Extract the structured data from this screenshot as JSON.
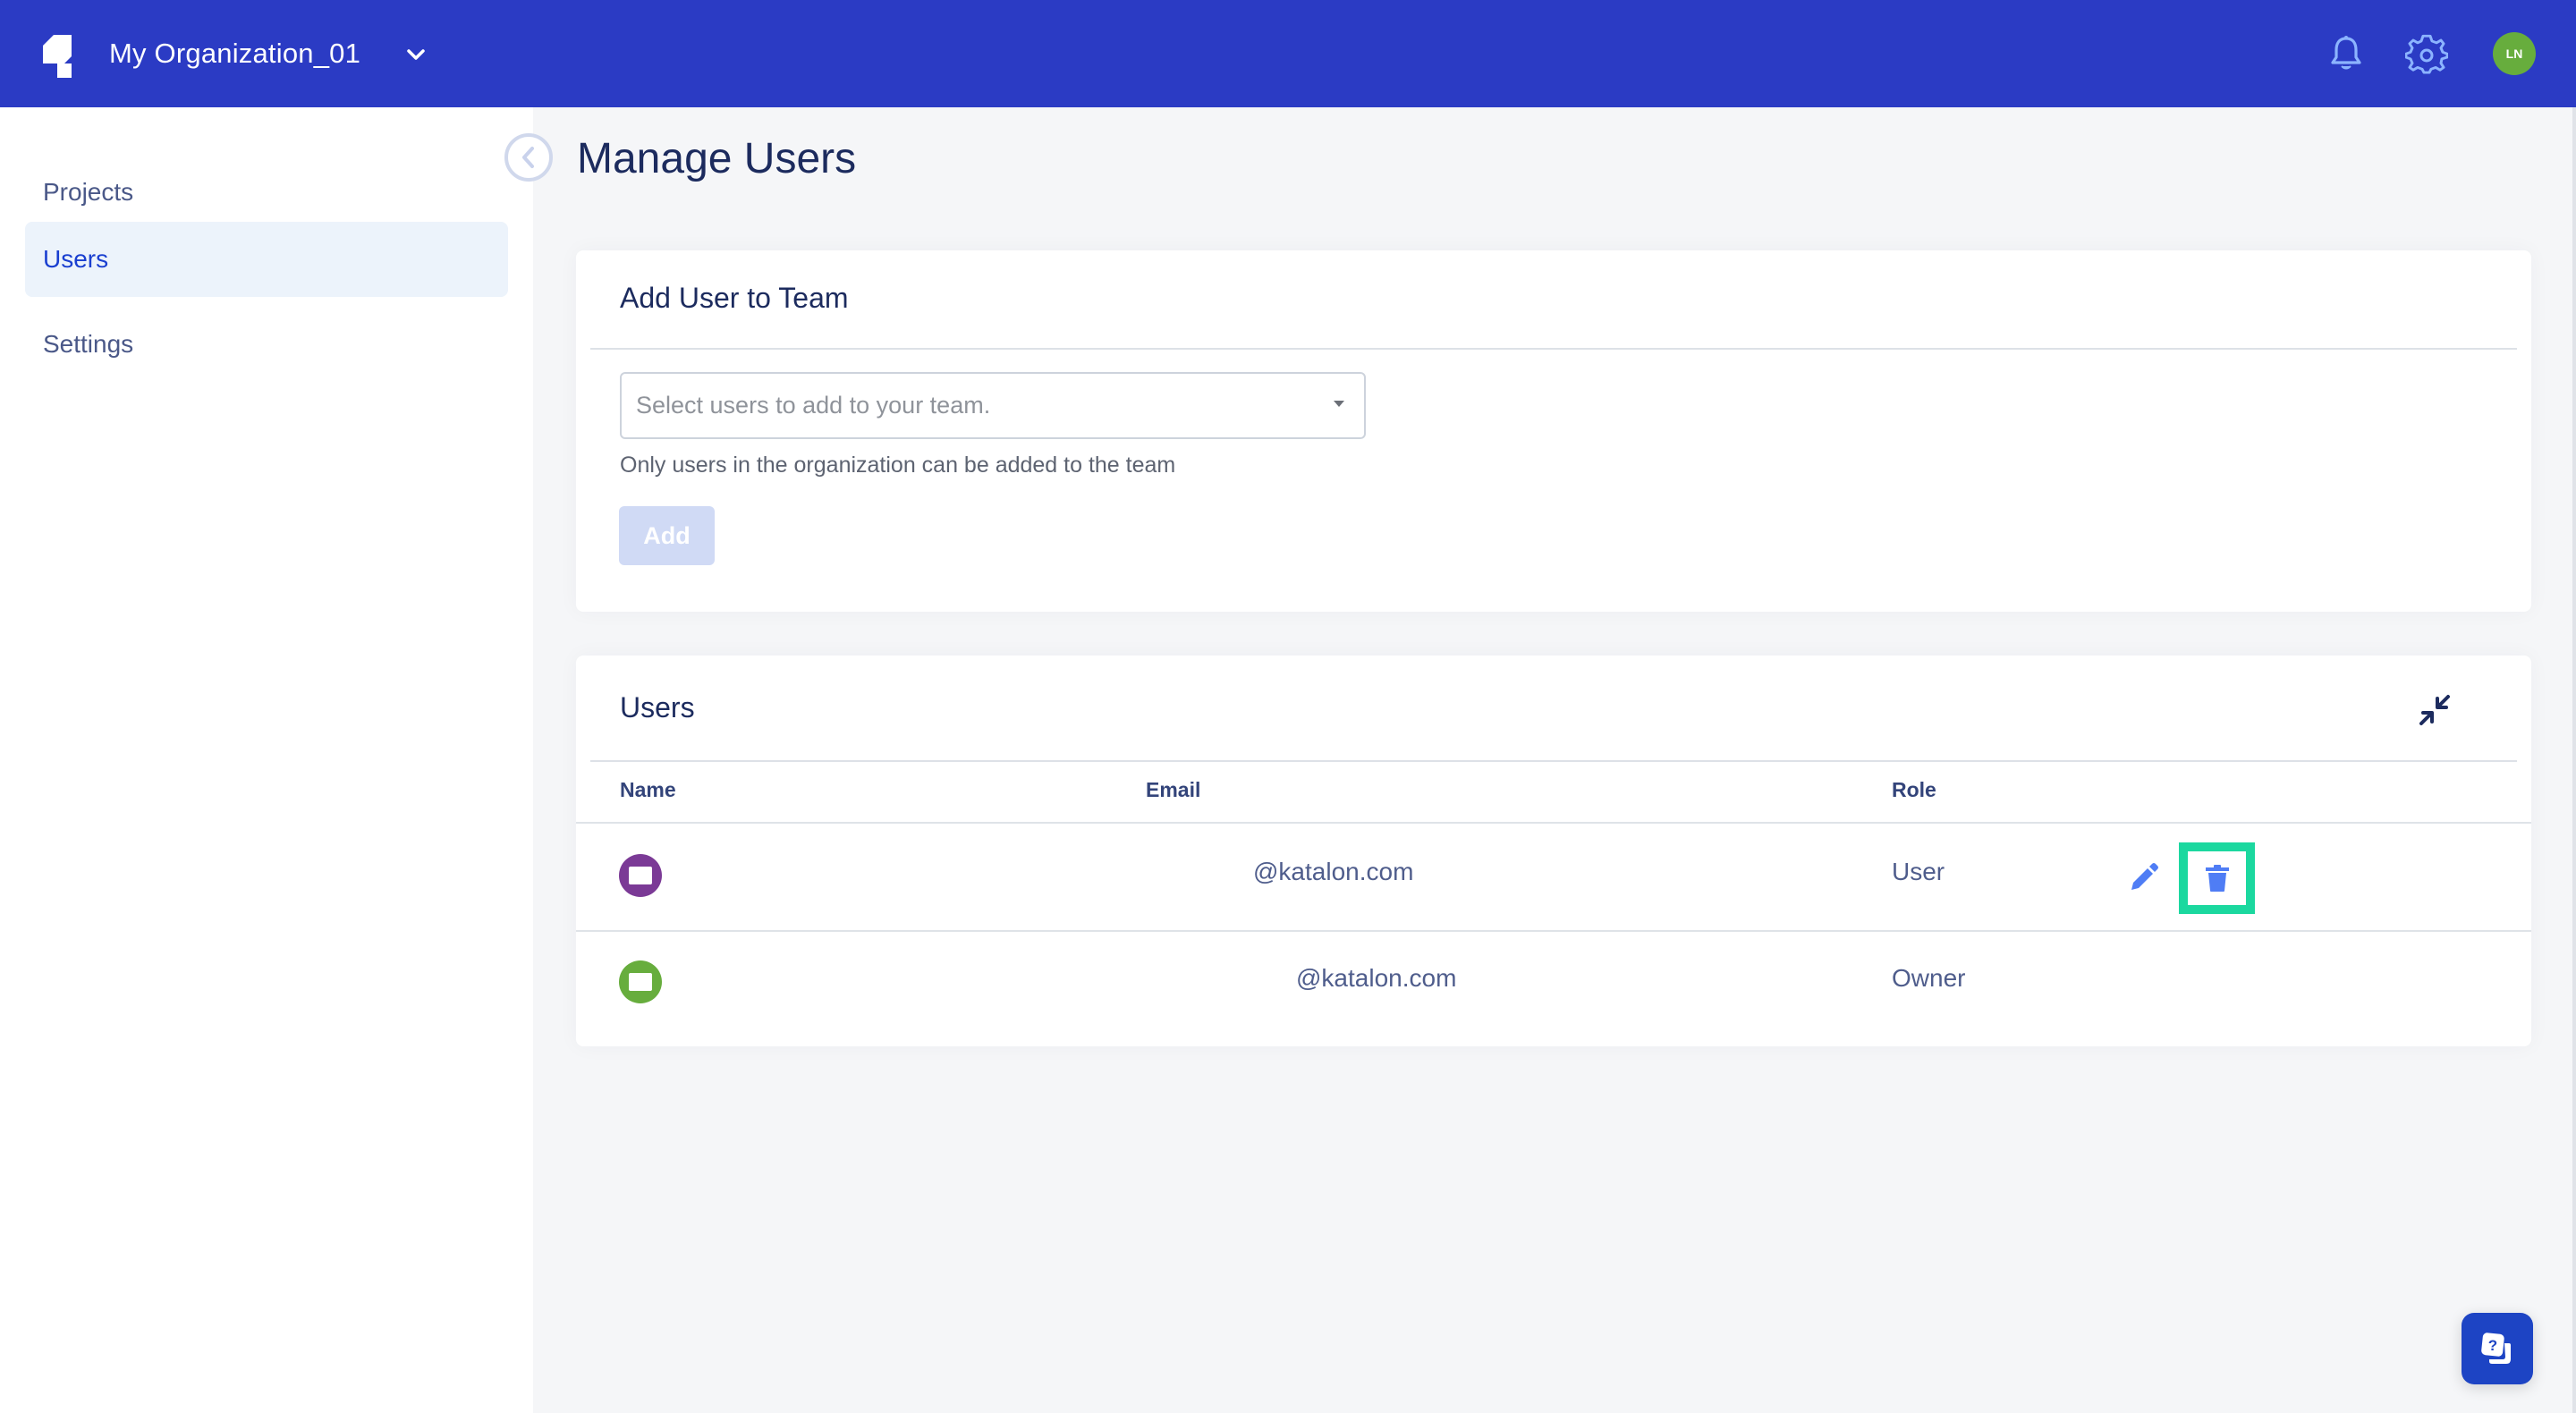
{
  "header": {
    "org_name": "My Organization_01",
    "user_initials": "LN",
    "icons": {
      "logo": "katalon-logo-icon",
      "org_dropdown": "chevron-down-icon",
      "notifications": "bell-icon",
      "settings": "gear-icon"
    }
  },
  "sidebar": {
    "items": [
      {
        "label": "Projects",
        "active": false
      },
      {
        "label": "Users",
        "active": true
      },
      {
        "label": "Settings",
        "active": false
      }
    ],
    "collapse_icon": "chevron-left-circle-icon"
  },
  "page": {
    "title": "Manage Users"
  },
  "add_user_card": {
    "title": "Add User to Team",
    "select_placeholder": "Select users to add to your team.",
    "helper_text": "Only users in the organization can be added to the team",
    "add_button_label": "Add",
    "add_button_disabled": true
  },
  "users_card": {
    "title": "Users",
    "collapse_icon": "shrink-arrows-icon",
    "columns": [
      "Name",
      "Email",
      "Role"
    ],
    "rows": [
      {
        "name": "",
        "avatar_color": "#7b3a96",
        "email": "@katalon.com",
        "role": "User",
        "actions": [
          "edit",
          "delete"
        ],
        "delete_highlighted": true
      },
      {
        "name": "",
        "avatar_color": "#67ad3d",
        "email": "@katalon.com",
        "role": "Owner",
        "actions": []
      }
    ]
  },
  "help_button_icon": "help-chat-icon",
  "colors": {
    "header_bg": "#2b3bc4",
    "accent": "#1a3fd0",
    "highlight": "#1bd89f",
    "action_icon": "#4f7df5"
  }
}
